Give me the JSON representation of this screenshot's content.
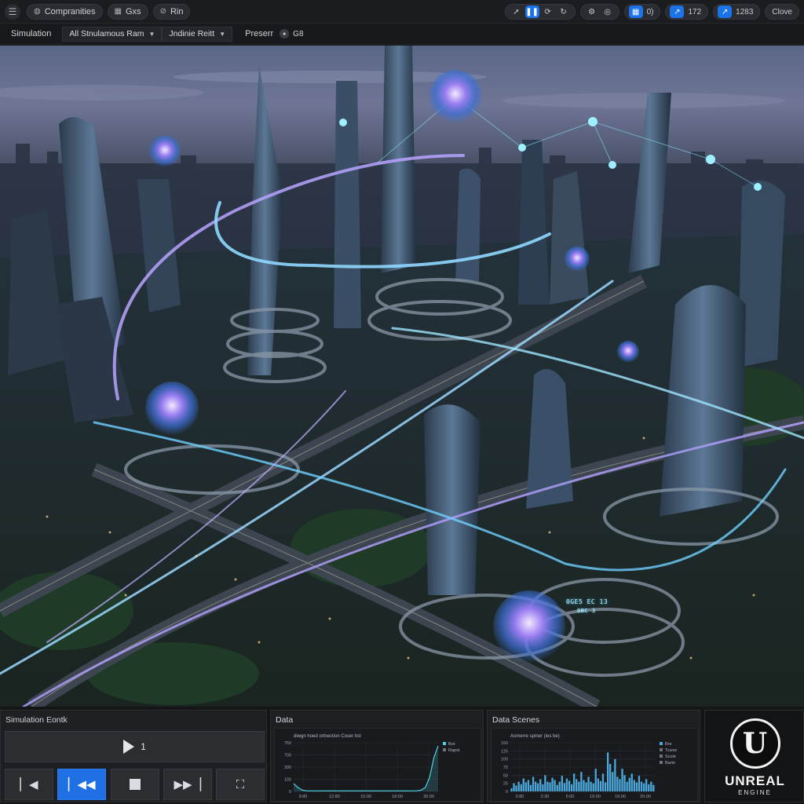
{
  "toolbar": {
    "menu_icon": "hamburger-icon",
    "items": [
      {
        "label": "Compranities",
        "icon": "globe-icon"
      },
      {
        "label": "Gxs",
        "icon": "grid-icon"
      },
      {
        "label": "Rin",
        "icon": "link-icon"
      }
    ],
    "right_values": {
      "group1": "0)",
      "group2": "172",
      "group3": "1283",
      "close_label": "Clove"
    }
  },
  "subbar": {
    "label": "Simulation",
    "dropdown1": "All Stnulamous Ram",
    "dropdown2": "Jndinie Reitt",
    "preset_label": "Preserr",
    "preset_value": "G8"
  },
  "viewport": {
    "hud_labels": [
      "0GE5 EC 13",
      "0BC 3"
    ]
  },
  "simulation_panel": {
    "title": "Simulation Eontk",
    "play_count": "1"
  },
  "data_panel": {
    "title": "Data",
    "chart_title": "diwgn hoed ortnection Coser bsl",
    "legend": [
      "Bot",
      "Rapst"
    ]
  },
  "scenes_panel": {
    "title": "Data Scenes",
    "chart_title": "Aomerre spiner (ies be)",
    "legend": [
      "Bre",
      "Tcwse",
      "Scote",
      "Barte"
    ]
  },
  "logo": {
    "name": "UNREAL",
    "sub": "ENGINE"
  },
  "colors": {
    "accent": "#1f6fe5",
    "line": "#4fd3e6",
    "bars": "#4aa8dc"
  },
  "chart_data": [
    {
      "type": "line",
      "title": "diwgn hoed ortnection Coser bsl",
      "x_ticks": [
        "9:80",
        "12:80",
        "15:00",
        "18:00",
        "30:00"
      ],
      "y_ticks": [
        "750",
        "700",
        "300",
        "100",
        "0"
      ],
      "ylim": [
        0,
        750
      ],
      "series": [
        {
          "name": "Bot",
          "values": [
            120,
            60,
            20,
            10,
            8,
            8,
            8,
            8,
            8,
            8,
            8,
            8,
            8,
            8,
            8,
            8,
            8,
            8,
            8,
            8,
            8,
            8,
            8,
            8,
            8,
            8,
            8,
            8,
            8,
            10,
            20,
            60,
            220,
            520,
            700
          ]
        }
      ],
      "legend": [
        "Bot",
        "Rapst"
      ],
      "grid": true
    },
    {
      "type": "bar",
      "title": "Aomerre spiner (ies be)",
      "x_ticks": [
        "0:80",
        "2:30",
        "5:00",
        "10:00",
        "16:00",
        "20:00"
      ],
      "y_ticks": [
        "150",
        "125",
        "100",
        "75",
        "50",
        "25",
        "0"
      ],
      "ylim": [
        0,
        150
      ],
      "values": [
        10,
        25,
        18,
        30,
        22,
        40,
        28,
        35,
        20,
        45,
        30,
        25,
        38,
        22,
        50,
        30,
        28,
        42,
        35,
        20,
        30,
        48,
        26,
        40,
        33,
        22,
        55,
        38,
        30,
        60,
        35,
        28,
        45,
        30,
        25,
        70,
        40,
        32,
        55,
        28,
        120,
        85,
        60,
        100,
        45,
        38,
        70,
        50,
        30,
        42,
        55,
        35,
        28,
        48,
        30,
        25,
        38,
        22,
        30,
        20
      ],
      "legend": [
        "Bre",
        "Tcwse",
        "Scote",
        "Barte"
      ],
      "grid": true
    }
  ]
}
